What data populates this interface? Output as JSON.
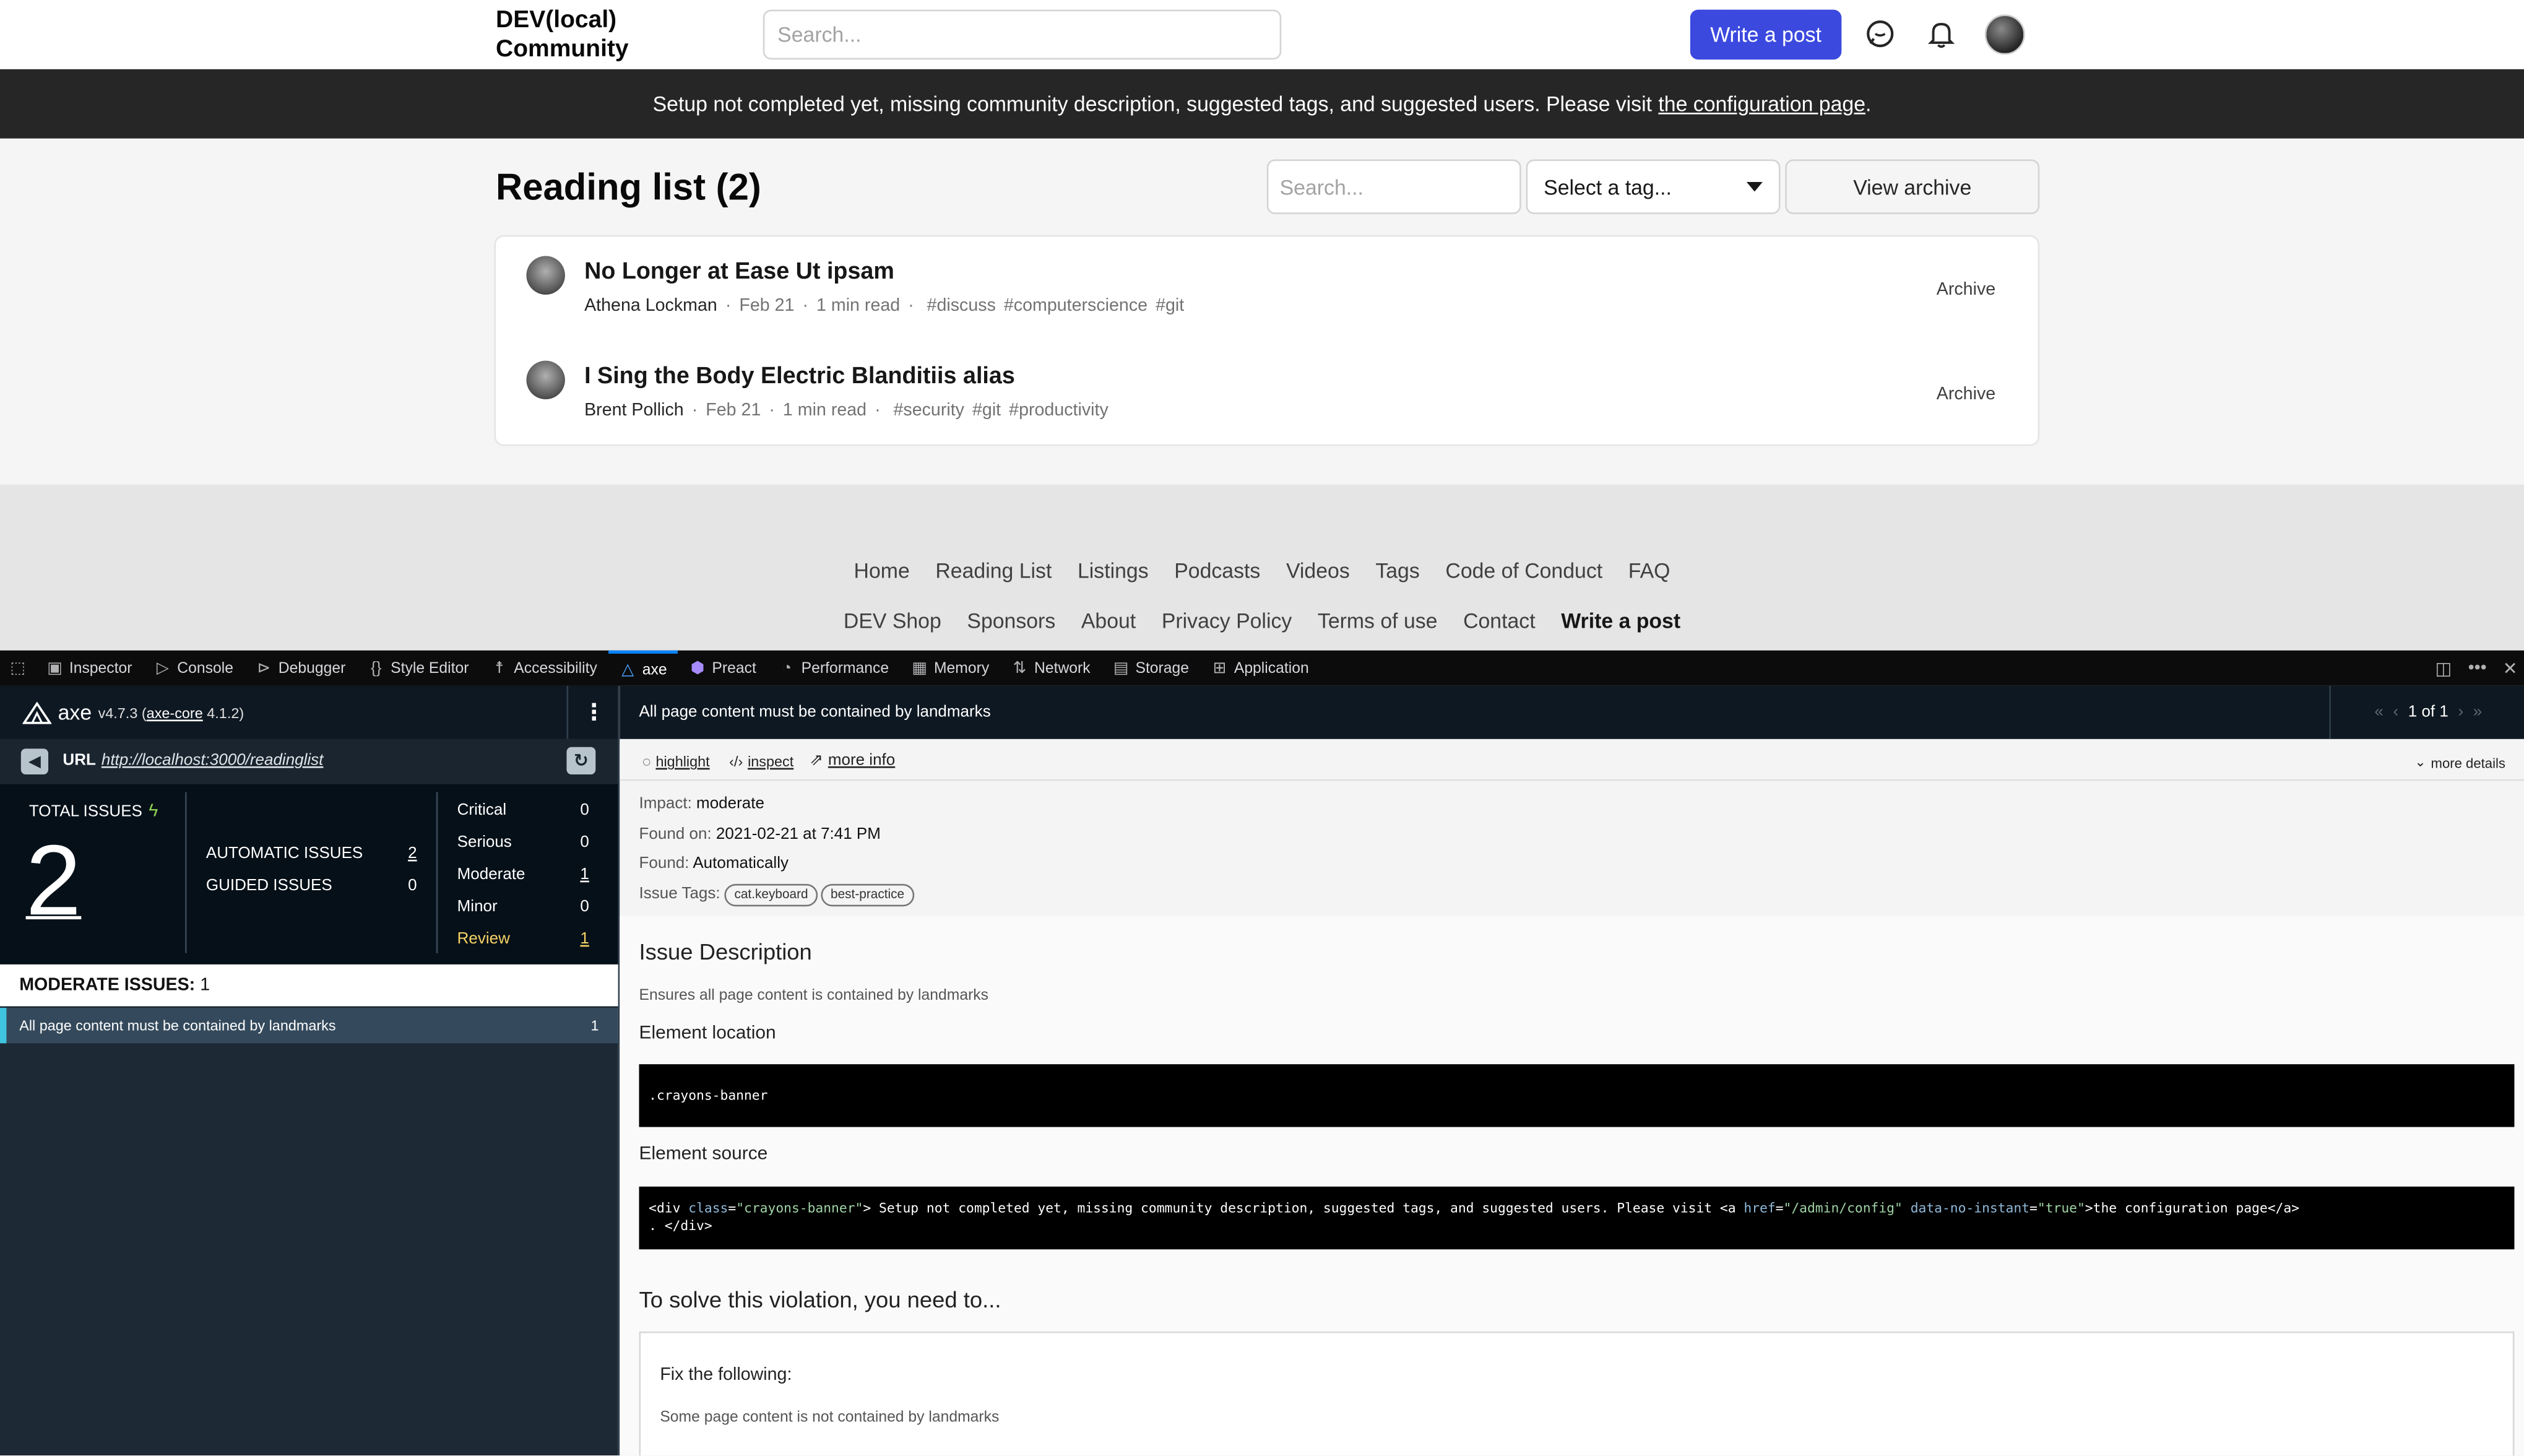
{
  "site": {
    "logo": "DEV(local) Community",
    "search_placeholder": "Search...",
    "write_post": "Write a post"
  },
  "banner": {
    "text": "Setup not completed yet, missing community description, suggested tags, and suggested users. Please visit",
    "link": "the configuration page",
    "period": "."
  },
  "reading": {
    "title": "Reading list (2)",
    "search_placeholder": "Search...",
    "tag_select": "Select a tag...",
    "view_archive": "View archive",
    "items": [
      {
        "title": "No Longer at Ease Ut ipsam",
        "author": "Athena Lockman",
        "date": "Feb 21",
        "read": "1 min read",
        "tags": [
          "#discuss",
          "#computerscience",
          "#git"
        ],
        "archive": "Archive"
      },
      {
        "title": "I Sing the Body Electric Blanditiis alias",
        "author": "Brent Pollich",
        "date": "Feb 21",
        "read": "1 min read",
        "tags": [
          "#security",
          "#git",
          "#productivity"
        ],
        "archive": "Archive"
      }
    ]
  },
  "footer": {
    "row1": [
      "Home",
      "Reading List",
      "Listings",
      "Podcasts",
      "Videos",
      "Tags",
      "Code of Conduct",
      "FAQ"
    ],
    "row2": [
      "DEV Shop",
      "Sponsors",
      "About",
      "Privacy Policy",
      "Terms of use",
      "Contact"
    ],
    "row2_strong": "Write a post"
  },
  "devtools": {
    "tabs": [
      {
        "label": "Inspector",
        "icon": "inspector-icon"
      },
      {
        "label": "Console",
        "icon": "console-icon"
      },
      {
        "label": "Debugger",
        "icon": "debugger-icon"
      },
      {
        "label": "Style Editor",
        "icon": "style-editor-icon"
      },
      {
        "label": "Accessibility",
        "icon": "accessibility-icon"
      },
      {
        "label": "axe",
        "icon": "axe-icon"
      },
      {
        "label": "Preact",
        "icon": "preact-icon"
      },
      {
        "label": "Performance",
        "icon": "performance-icon"
      },
      {
        "label": "Memory",
        "icon": "memory-icon"
      },
      {
        "label": "Network",
        "icon": "network-icon"
      },
      {
        "label": "Storage",
        "icon": "storage-icon"
      },
      {
        "label": "Application",
        "icon": "application-icon"
      }
    ],
    "active_tab": "axe"
  },
  "axe": {
    "name": "axe",
    "version": "v4.7.3",
    "core_label": "axe-core",
    "core_version": "4.1.2",
    "url_label": "URL",
    "url": "http://localhost:3000/readinglist",
    "total_label": "TOTAL ISSUES",
    "total": "2",
    "automatic_label": "AUTOMATIC ISSUES",
    "automatic": "2",
    "guided_label": "GUIDED ISSUES",
    "guided": "0",
    "severity": [
      {
        "label": "Critical",
        "count": "0"
      },
      {
        "label": "Serious",
        "count": "0"
      },
      {
        "label": "Moderate",
        "count": "1"
      },
      {
        "label": "Minor",
        "count": "0"
      },
      {
        "label": "Review",
        "count": "1"
      }
    ],
    "moderate_head": "MODERATE ISSUES:",
    "moderate_count": "1",
    "issue_item": "All page content must be contained by landmarks",
    "issue_item_count": "1"
  },
  "detail": {
    "title": "All page content must be contained by landmarks",
    "pager": "1 of 1",
    "highlight": "highlight",
    "inspect": "inspect",
    "more_info": "more info",
    "more_details": "more details",
    "impact_label": "Impact:",
    "impact": "moderate",
    "found_on_label": "Found on:",
    "found_on": "2021-02-21 at 7:41 PM",
    "found_label": "Found:",
    "found": "Automatically",
    "tags_label": "Issue Tags:",
    "tags": [
      "cat.keyboard",
      "best-practice"
    ],
    "desc_heading": "Issue Description",
    "desc": "Ensures all page content is contained by landmarks",
    "loc_heading": "Element location",
    "loc": ".crayons-banner",
    "src_heading": "Element source",
    "src_text": "Setup not completed yet, missing community description, suggested tags, and suggested users. Please visit",
    "src_link_text": "the configuration page",
    "solve_heading": "To solve this violation, you need to...",
    "fix_heading": "Fix the following:",
    "fix_text": "Some page content is not contained by landmarks"
  },
  "colors": {
    "accent": "#3b49df",
    "banner": "#262626",
    "axe_dark": "#1d2935",
    "issue_highlight": "#3fc4e0",
    "review": "#f6d365"
  }
}
